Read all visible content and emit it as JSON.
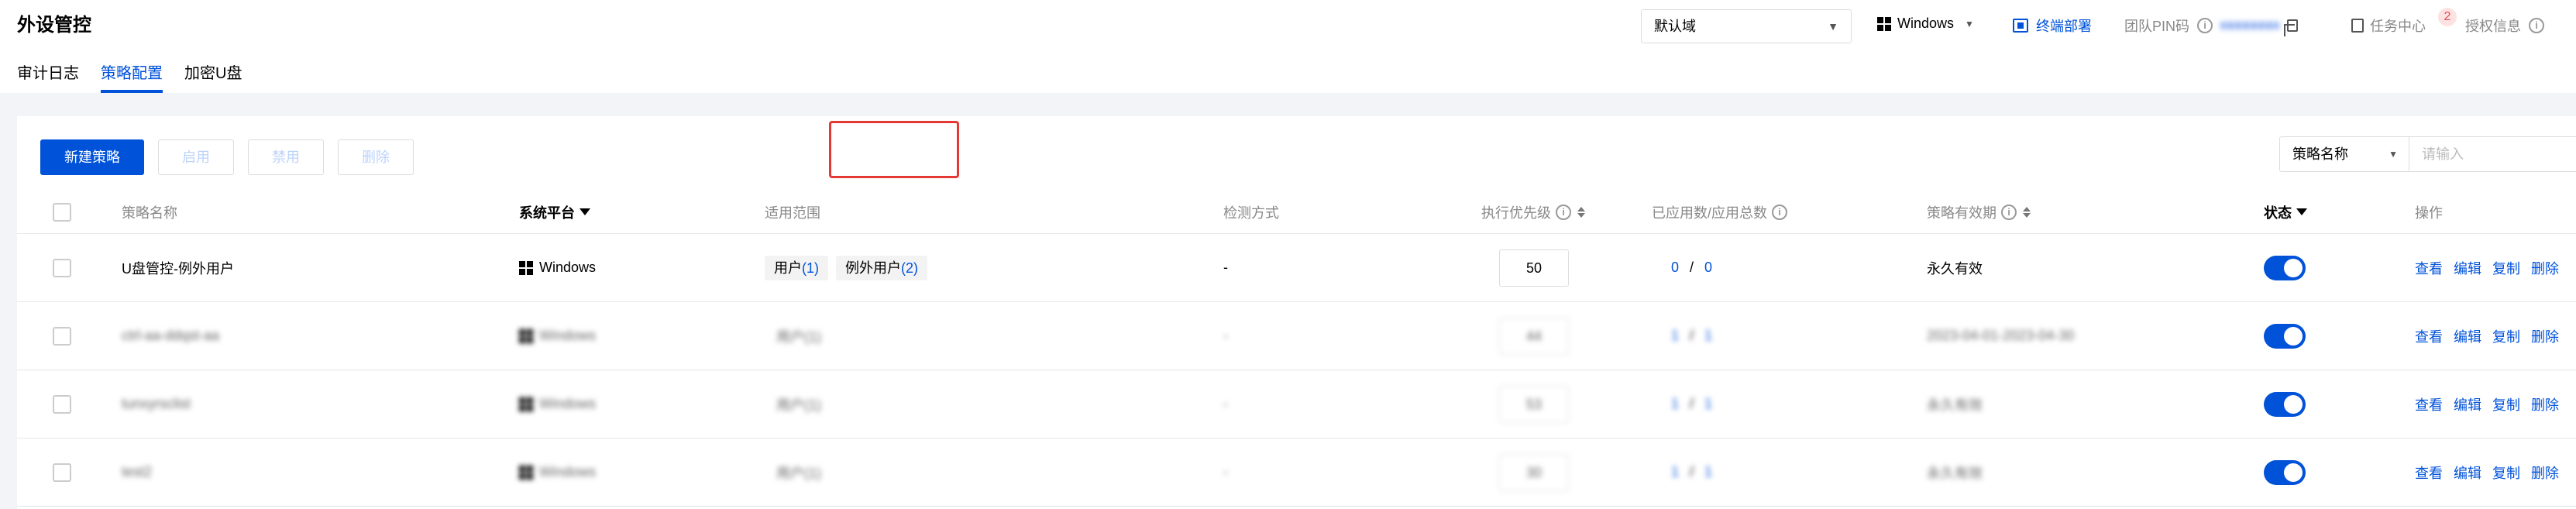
{
  "header": {
    "title": "外设管控",
    "tabs": [
      {
        "label": "审计日志",
        "active": false
      },
      {
        "label": "策略配置",
        "active": true
      },
      {
        "label": "加密U盘",
        "active": false
      }
    ],
    "domain_select": "默认域",
    "os_select": "Windows",
    "terminal_deploy": "终端部署",
    "team_pin_label": "团队PIN码",
    "task_center": "任务中心",
    "task_badge": "2",
    "license_info": "授权信息"
  },
  "toolbar": {
    "new_policy": "新建策略",
    "enable": "启用",
    "disable": "禁用",
    "delete": "删除"
  },
  "search": {
    "field": "策略名称",
    "placeholder": "请输入"
  },
  "table": {
    "columns": {
      "name": "策略名称",
      "platform": "系统平台",
      "scope": "适用范围",
      "detection": "检测方式",
      "priority": "执行优先级",
      "applied": "已应用数/应用总数",
      "validity": "策略有效期",
      "status": "状态",
      "actions": "操作"
    },
    "rows": [
      {
        "name": "U盘管控-例外用户",
        "platform": "Windows",
        "scope_tags": [
          {
            "label": "用户",
            "count": "(1)"
          },
          {
            "label": "例外用户",
            "count": "(2)"
          }
        ],
        "detection": "-",
        "priority": "50",
        "applied": "0",
        "total": "0",
        "validity": "永久有效",
        "enabled": true,
        "actions": [
          "查看",
          "编辑",
          "复制",
          "删除"
        ]
      },
      {
        "name": "ctrl-aa-ddqst-aa",
        "platform": "Windows",
        "scope": "用户(1)",
        "detection": "-",
        "priority": "44",
        "applied": "1",
        "total": "1",
        "validity": "2023-04-01-2023-04-30",
        "enabled": true,
        "actions": [
          "查看",
          "编辑",
          "复制",
          "删除"
        ]
      },
      {
        "name": "tunxyrsclist",
        "platform": "Windows",
        "scope": "用户(1)",
        "detection": "-",
        "priority": "53",
        "applied": "1",
        "total": "1",
        "validity": "永久有效",
        "enabled": true,
        "actions": [
          "查看",
          "编辑",
          "复制",
          "删除"
        ]
      },
      {
        "name": "test2",
        "platform": "Windows",
        "scope": "用户(1)",
        "detection": "-",
        "priority": "30",
        "applied": "1",
        "total": "1",
        "validity": "永久有效",
        "enabled": true,
        "actions": [
          "查看",
          "编辑",
          "复制",
          "删除"
        ]
      }
    ]
  }
}
